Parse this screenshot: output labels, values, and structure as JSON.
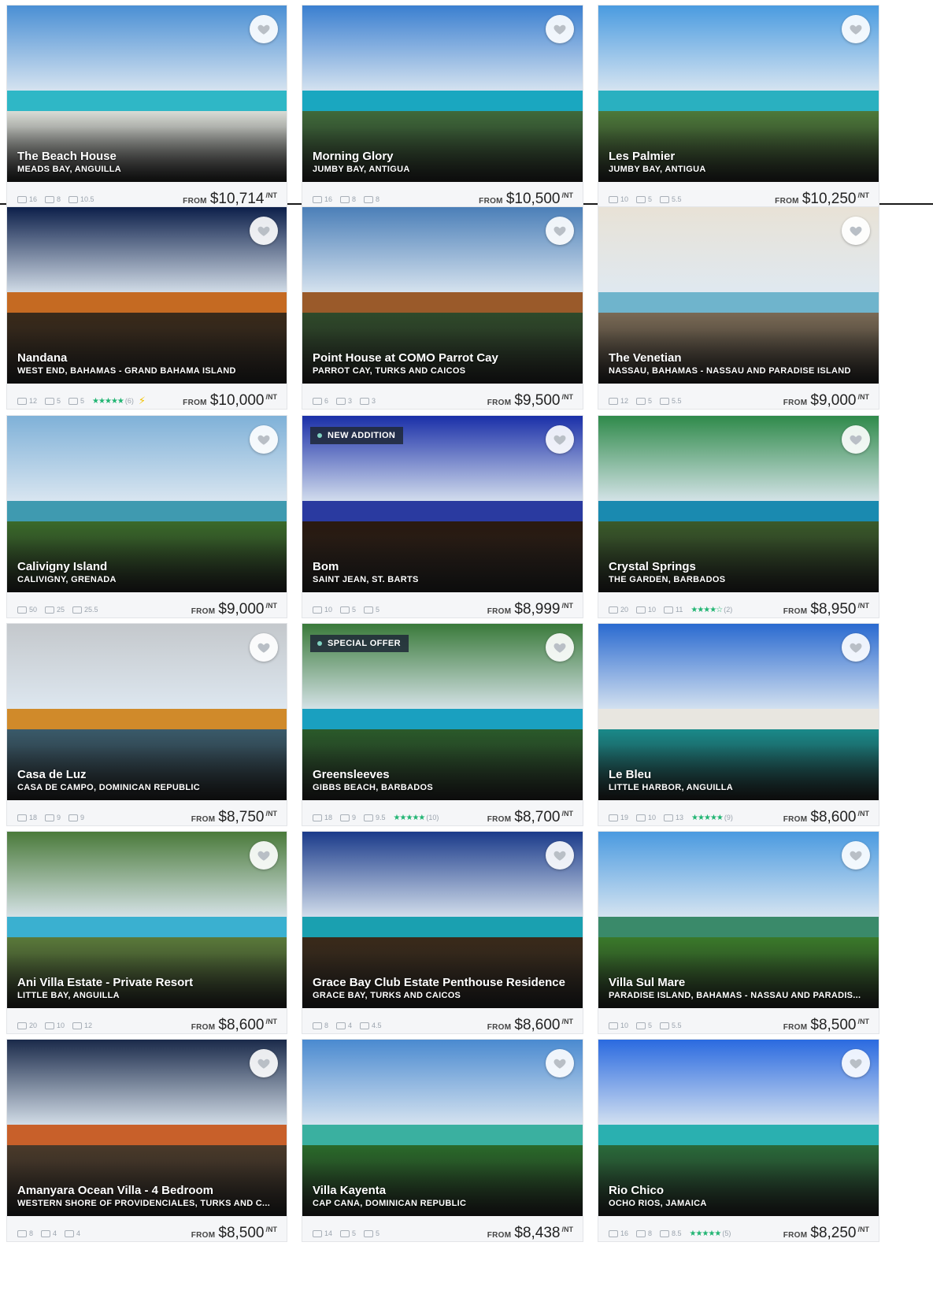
{
  "price_prefix": "FROM",
  "price_suffix": "/NT",
  "colors": {
    "card_bg": "#f5f6f8",
    "stars": "#22b573",
    "badge_bg": "#1e2837"
  },
  "listings": [
    {
      "title": "The Beach House",
      "location": "MEADS BAY, ANGUILLA",
      "bedrooms": "16",
      "bathrooms": "8",
      "baths2": "10.5",
      "price": "$10,714",
      "palette": [
        "#4a8fd4",
        "#2fb7c6",
        "#d9dcd6"
      ]
    },
    {
      "title": "Morning Glory",
      "location": "JUMBY BAY, ANTIGUA",
      "bedrooms": "16",
      "bathrooms": "8",
      "baths2": "8",
      "price": "$10,500",
      "palette": [
        "#3a7fd0",
        "#1aa7c0",
        "#3f6a3a"
      ]
    },
    {
      "title": "Les Palmier",
      "location": "JUMBY BAY, ANTIGUA",
      "bedrooms": "10",
      "bathrooms": "5",
      "baths2": "5.5",
      "price": "$10,250",
      "palette": [
        "#4a9be0",
        "#2ab0c0",
        "#4d7a3a"
      ]
    },
    {
      "title": "Nandana",
      "location": "WEST END, BAHAMAS - GRAND BAHAMA ISLAND",
      "bedrooms": "12",
      "bathrooms": "5",
      "baths2": "5",
      "stars": "★★★★★",
      "reviews": "(6)",
      "instant": "⚡",
      "price": "$10,000",
      "palette": [
        "#0c1f4a",
        "#c56a22",
        "#3a2a1a"
      ]
    },
    {
      "title": "Point House at COMO Parrot Cay",
      "location": "PARROT CAY, TURKS AND CAICOS",
      "bedrooms": "6",
      "bathrooms": "3",
      "baths2": "3",
      "price": "$9,500",
      "palette": [
        "#4b7fb8",
        "#9a5a2a",
        "#2f4a2a"
      ]
    },
    {
      "title": "The Venetian",
      "location": "NASSAU, BAHAMAS - NASSAU AND PARADISE ISLAND",
      "bedrooms": "12",
      "bathrooms": "5",
      "baths2": "5.5",
      "price": "$9,000",
      "palette": [
        "#e8e2d6",
        "#6fb4cc",
        "#7a6a55"
      ]
    },
    {
      "title": "Calivigny Island",
      "location": "CALIVIGNY, GRENADA",
      "bedrooms": "50",
      "bathrooms": "25",
      "baths2": "25.5",
      "price": "$9,000",
      "palette": [
        "#7fb1d8",
        "#3f9ab0",
        "#3a6a2a"
      ]
    },
    {
      "title": "Bom",
      "location": "SAINT JEAN, ST. BARTS",
      "bedrooms": "10",
      "bathrooms": "5",
      "baths2": "5",
      "badge": "NEW ADDITION",
      "price": "$8,999",
      "palette": [
        "#1a2fa8",
        "#2a3aa0",
        "#2a1a10"
      ]
    },
    {
      "title": "Crystal Springs",
      "location": "THE GARDEN, BARBADOS",
      "bedrooms": "20",
      "bathrooms": "10",
      "baths2": "11",
      "stars": "★★★★☆",
      "reviews": "(2)",
      "price": "$8,950",
      "palette": [
        "#2f8a4a",
        "#1a8ab0",
        "#3a5a2a"
      ]
    },
    {
      "title": "Casa de Luz",
      "location": "CASA DE CAMPO, DOMINICAN REPUBLIC",
      "bedrooms": "18",
      "bathrooms": "9",
      "baths2": "9",
      "price": "$8,750",
      "palette": [
        "#c4c8cc",
        "#d08a2a",
        "#3a5a6a"
      ]
    },
    {
      "title": "Greensleeves",
      "location": "GIBBS BEACH, BARBADOS",
      "bedrooms": "18",
      "bathrooms": "9",
      "baths2": "9.5",
      "stars": "★★★★★",
      "reviews": "(10)",
      "badge": "SPECIAL OFFER",
      "price": "$8,700",
      "palette": [
        "#3a7a3a",
        "#1aa0c0",
        "#2a5a2a"
      ]
    },
    {
      "title": "Le Bleu",
      "location": "LITTLE HARBOR, ANGUILLA",
      "bedrooms": "19",
      "bathrooms": "10",
      "baths2": "13",
      "stars": "★★★★★",
      "reviews": "(9)",
      "price": "$8,600",
      "palette": [
        "#2a6ad0",
        "#e8e6e0",
        "#1a8a8a"
      ]
    },
    {
      "title": "Ani Villa Estate - Private Resort",
      "location": "LITTLE BAY, ANGUILLA",
      "bedrooms": "20",
      "bathrooms": "10",
      "baths2": "12",
      "price": "$8,600",
      "palette": [
        "#4a7a3a",
        "#3ab0d0",
        "#5a7a3a"
      ]
    },
    {
      "title": "Grace Bay Club Estate Penthouse Residence",
      "location": "GRACE BAY, TURKS AND CAICOS",
      "bedrooms": "8",
      "bathrooms": "4",
      "baths2": "4.5",
      "price": "$8,600",
      "palette": [
        "#1a3a8a",
        "#1aa0b0",
        "#3a2a1a"
      ]
    },
    {
      "title": "Villa Sul Mare",
      "location": "PARADISE ISLAND, BAHAMAS - NASSAU AND PARADIS...",
      "bedrooms": "10",
      "bathrooms": "5",
      "baths2": "5.5",
      "price": "$8,500",
      "palette": [
        "#4a9ae0",
        "#3a8a6a",
        "#3a7a2a"
      ]
    },
    {
      "title": "Amanyara Ocean Villa - 4 Bedroom",
      "location": "WESTERN SHORE OF PROVIDENCIALES, TURKS AND C...",
      "bedrooms": "8",
      "bathrooms": "4",
      "baths2": "4",
      "price": "$8,500",
      "palette": [
        "#1a2a4a",
        "#c8602a",
        "#4a3a2a"
      ]
    },
    {
      "title": "Villa Kayenta",
      "location": "CAP CANA, DOMINICAN REPUBLIC",
      "bedrooms": "14",
      "bathrooms": "5",
      "baths2": "5",
      "price": "$8,438",
      "palette": [
        "#4a8ad0",
        "#3ab0a0",
        "#2a6a2a"
      ]
    },
    {
      "title": "Rio Chico",
      "location": "OCHO RIOS, JAMAICA",
      "bedrooms": "16",
      "bathrooms": "8",
      "baths2": "8.5",
      "stars": "★★★★★",
      "reviews": "(5)",
      "price": "$8,250",
      "palette": [
        "#2a6ae0",
        "#2ab0b0",
        "#2a6a3a"
      ]
    }
  ]
}
